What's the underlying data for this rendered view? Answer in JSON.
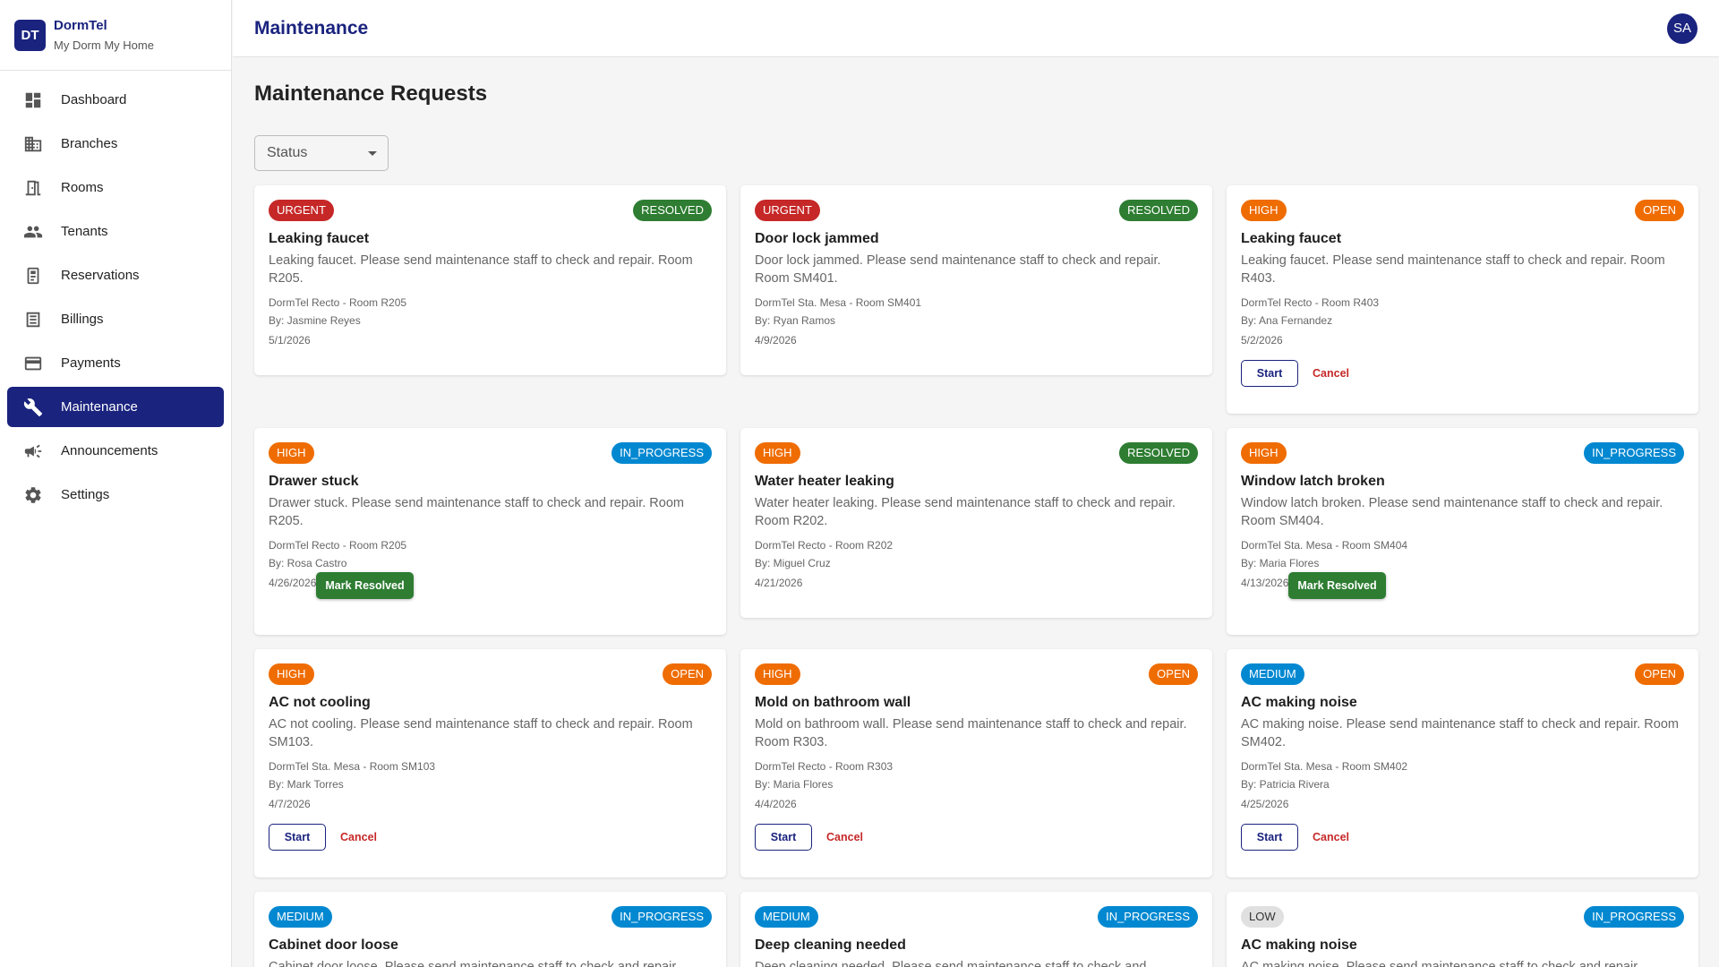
{
  "brand": {
    "logo": "DT",
    "name": "DormTel",
    "tagline": "My Dorm My Home"
  },
  "sidebar": {
    "items": [
      {
        "label": "Dashboard",
        "icon": "dashboard-icon"
      },
      {
        "label": "Branches",
        "icon": "building-icon"
      },
      {
        "label": "Rooms",
        "icon": "door-icon"
      },
      {
        "label": "Tenants",
        "icon": "people-icon"
      },
      {
        "label": "Reservations",
        "icon": "clipboard-icon"
      },
      {
        "label": "Billings",
        "icon": "receipt-icon"
      },
      {
        "label": "Payments",
        "icon": "credit-card-icon"
      },
      {
        "label": "Maintenance",
        "icon": "wrench-icon",
        "active": true
      },
      {
        "label": "Announcements",
        "icon": "megaphone-icon"
      },
      {
        "label": "Settings",
        "icon": "gear-icon"
      }
    ]
  },
  "header": {
    "title": "Maintenance",
    "avatar": "SA"
  },
  "main": {
    "page_title": "Maintenance Requests",
    "status_filter": {
      "label": "Status"
    }
  },
  "requests": [
    {
      "priority": "URGENT",
      "status": "RESOLVED",
      "title": "Leaking faucet",
      "description": "Leaking faucet. Please send maintenance staff to check and repair. Room R205.",
      "location": "DormTel Recto - Room R205",
      "by": "By: Jasmine Reyes",
      "date": "5/1/2026"
    },
    {
      "priority": "URGENT",
      "status": "RESOLVED",
      "title": "Door lock jammed",
      "description": "Door lock jammed. Please send maintenance staff to check and repair. Room SM401.",
      "location": "DormTel Sta. Mesa - Room SM401",
      "by": "By: Ryan Ramos",
      "date": "4/9/2026"
    },
    {
      "priority": "HIGH",
      "status": "OPEN",
      "title": "Leaking faucet",
      "description": "Leaking faucet. Please send maintenance staff to check and repair. Room R403.",
      "location": "DormTel Recto - Room R403",
      "by": "By: Ana Fernandez",
      "date": "5/2/2026",
      "start_label": "Start",
      "cancel_label": "Cancel"
    },
    {
      "priority": "HIGH",
      "status": "IN_PROGRESS",
      "title": "Drawer stuck",
      "description": "Drawer stuck. Please send maintenance staff to check and repair. Room R205.",
      "location": "DormTel Recto - Room R205",
      "by": "By: Rosa Castro",
      "date": "4/26/2026",
      "resolve_label": "Mark Resolved"
    },
    {
      "priority": "HIGH",
      "status": "RESOLVED",
      "title": "Water heater leaking",
      "description": "Water heater leaking. Please send maintenance staff to check and repair. Room R202.",
      "location": "DormTel Recto - Room R202",
      "by": "By: Miguel Cruz",
      "date": "4/21/2026"
    },
    {
      "priority": "HIGH",
      "status": "IN_PROGRESS",
      "title": "Window latch broken",
      "description": "Window latch broken. Please send maintenance staff to check and repair. Room SM404.",
      "location": "DormTel Sta. Mesa - Room SM404",
      "by": "By: Maria Flores",
      "date": "4/13/2026",
      "resolve_label": "Mark Resolved"
    },
    {
      "priority": "HIGH",
      "status": "OPEN",
      "title": "AC not cooling",
      "description": "AC not cooling. Please send maintenance staff to check and repair. Room SM103.",
      "location": "DormTel Sta. Mesa - Room SM103",
      "by": "By: Mark Torres",
      "date": "4/7/2026",
      "start_label": "Start",
      "cancel_label": "Cancel"
    },
    {
      "priority": "HIGH",
      "status": "OPEN",
      "title": "Mold on bathroom wall",
      "description": "Mold on bathroom wall. Please send maintenance staff to check and repair. Room R303.",
      "location": "DormTel Recto - Room R303",
      "by": "By: Maria Flores",
      "date": "4/4/2026",
      "start_label": "Start",
      "cancel_label": "Cancel"
    },
    {
      "priority": "MEDIUM",
      "status": "OPEN",
      "title": "AC making noise",
      "description": "AC making noise. Please send maintenance staff to check and repair. Room SM402.",
      "location": "DormTel Sta. Mesa - Room SM402",
      "by": "By: Patricia Rivera",
      "date": "4/25/2026",
      "start_label": "Start",
      "cancel_label": "Cancel"
    },
    {
      "priority": "MEDIUM",
      "status": "IN_PROGRESS",
      "title": "Cabinet door loose",
      "description": "Cabinet door loose. Please send maintenance staff to check and repair."
    },
    {
      "priority": "MEDIUM",
      "status": "IN_PROGRESS",
      "title": "Deep cleaning needed",
      "description": "Deep cleaning needed. Please send maintenance staff to check and"
    },
    {
      "priority": "LOW",
      "status": "IN_PROGRESS",
      "title": "AC making noise",
      "description": "AC making noise. Please send maintenance staff to check and repair."
    }
  ]
}
